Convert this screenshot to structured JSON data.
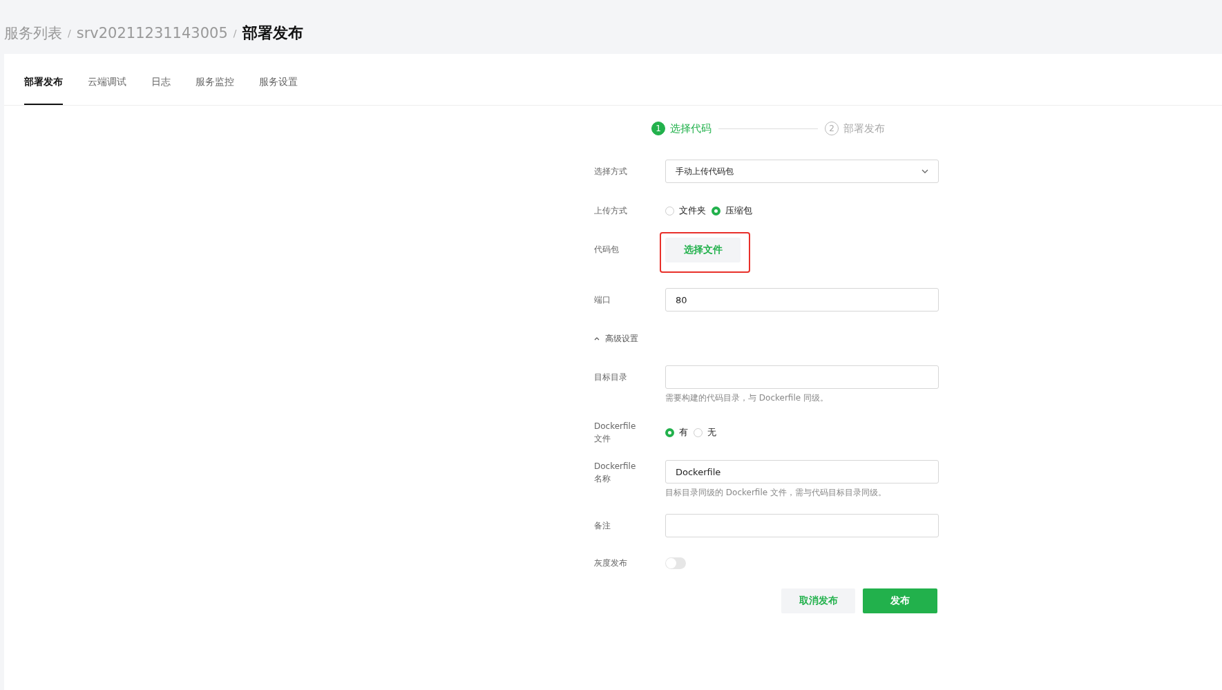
{
  "breadcrumb": [
    {
      "label": "服务列表",
      "current": false
    },
    {
      "label": "srv20211231143005",
      "current": false
    },
    {
      "label": "部署发布",
      "current": true
    }
  ],
  "breadcrumb_separator": "/",
  "tabs": [
    {
      "label": "部署发布",
      "selected": true
    },
    {
      "label": "云端调试",
      "selected": false
    },
    {
      "label": "日志",
      "selected": false
    },
    {
      "label": "服务监控",
      "selected": false
    },
    {
      "label": "服务设置",
      "selected": false
    }
  ],
  "steps": [
    {
      "number": "1",
      "label": "选择代码",
      "selected": true
    },
    {
      "number": "2",
      "label": "部署发布",
      "selected": false
    }
  ],
  "form": [
    {
      "kind": "select",
      "label": "选择方式",
      "value": "手动上传代码包"
    },
    {
      "kind": "radio",
      "label": "上传方式",
      "options": [
        {
          "label": "文件夹",
          "selected": false
        },
        {
          "label": "压缩包",
          "selected": true
        }
      ]
    },
    {
      "kind": "file",
      "label": "代码包",
      "button": "选择文件",
      "highlighted": true
    },
    {
      "kind": "input",
      "label": "端口",
      "value": "80"
    },
    {
      "kind": "section",
      "label": "高级设置",
      "expanded": true
    },
    {
      "kind": "input",
      "label": "目标目录",
      "hint": "需要构建的代码目录，与 Dockerfile 同级。"
    },
    {
      "kind": "radio",
      "label": "Dockerfile 文件",
      "options": [
        {
          "label": "有",
          "selected": true
        },
        {
          "label": "无",
          "selected": false
        }
      ]
    },
    {
      "kind": "input",
      "label": "Dockerfile 名称",
      "value": "Dockerfile",
      "hint": "目标目录同级的 Dockerfile 文件，需与代码目标目录同级。"
    },
    {
      "kind": "input",
      "label": "备注"
    },
    {
      "kind": "toggle",
      "label": "灰度发布",
      "on": false
    }
  ],
  "actions": [
    {
      "label": "取消发布",
      "primary": false
    },
    {
      "label": "发布",
      "primary": true
    }
  ]
}
